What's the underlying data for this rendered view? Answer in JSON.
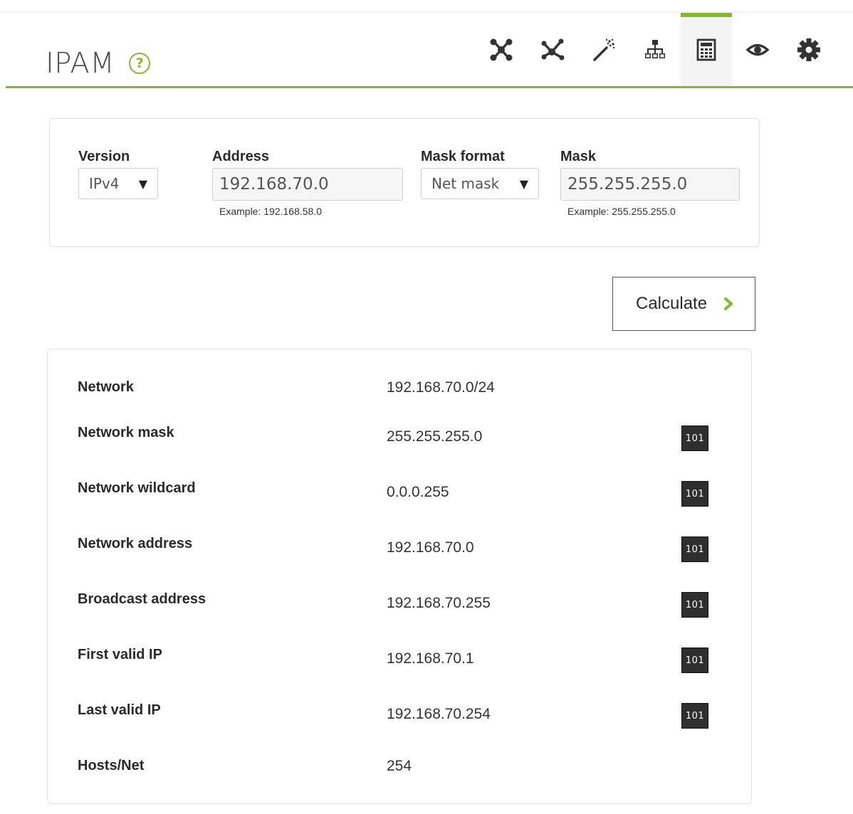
{
  "header": {
    "title": "IPAM",
    "help_glyph": "?",
    "toolbar": [
      {
        "icon": "network-map-icon",
        "active": false
      },
      {
        "icon": "recon-icon",
        "active": false
      },
      {
        "icon": "magic-wand-icon",
        "active": false
      },
      {
        "icon": "sitemap-icon",
        "active": false
      },
      {
        "icon": "calculator-icon",
        "active": true
      },
      {
        "icon": "eye-icon",
        "active": false
      },
      {
        "icon": "gear-icon",
        "active": false
      }
    ]
  },
  "form": {
    "version": {
      "label": "Version",
      "value": "IPv4"
    },
    "address": {
      "label": "Address",
      "value": "192.168.70.0",
      "example": "Example: 192.168.58.0"
    },
    "mask_format": {
      "label": "Mask format",
      "value": "Net mask"
    },
    "mask": {
      "label": "Mask",
      "value": "255.255.255.0",
      "example": "Example: 255.255.255.0"
    },
    "caret": "▼"
  },
  "calculate": {
    "label": "Calculate"
  },
  "results": {
    "binary_label": "101",
    "rows": [
      {
        "label": "Network",
        "value": "192.168.70.0/24"
      },
      {
        "label": "Network mask",
        "value": "255.255.255.0"
      },
      {
        "label": "Network wildcard",
        "value": "0.0.0.255"
      },
      {
        "label": "Network address",
        "value": "192.168.70.0"
      },
      {
        "label": "Broadcast address",
        "value": "192.168.70.255"
      },
      {
        "label": "First valid IP",
        "value": "192.168.70.1"
      },
      {
        "label": "Last valid IP",
        "value": "192.168.70.254"
      },
      {
        "label": "Hosts/Net",
        "value": "254"
      }
    ]
  },
  "colors": {
    "accent": "#82b92e",
    "icon": "#333333",
    "binary_button": "#2f2f2f"
  }
}
